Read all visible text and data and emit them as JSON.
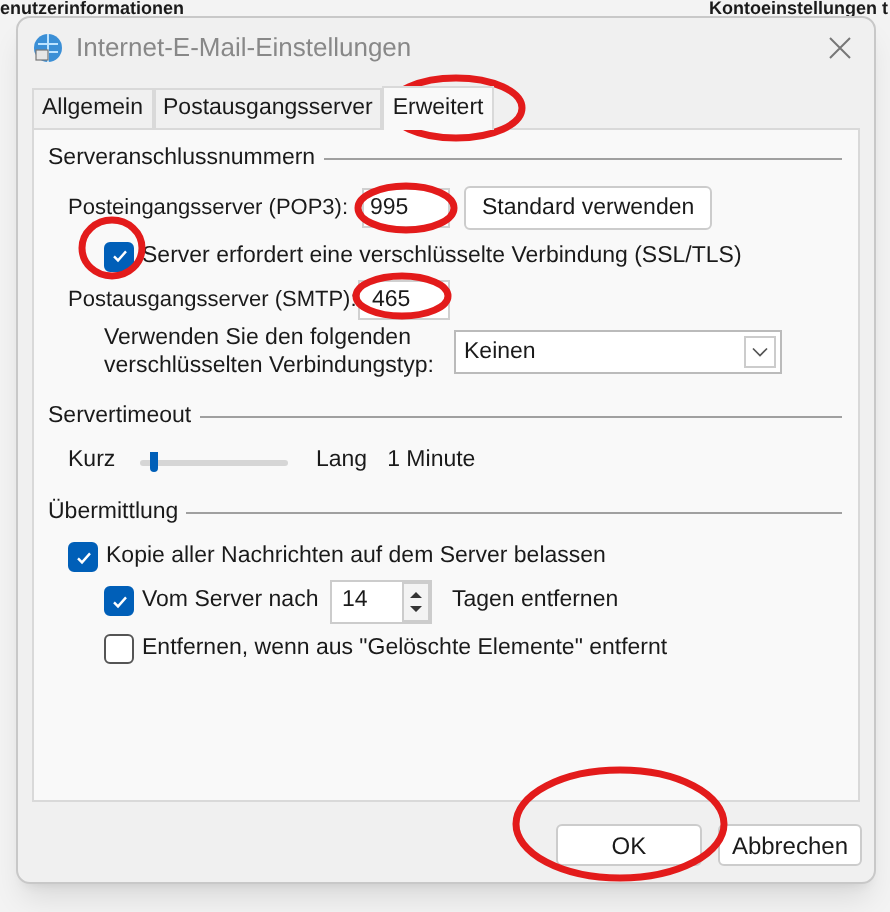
{
  "background": {
    "headings": [
      "enutzerinformationen",
      "Kontoeinstellungen t"
    ]
  },
  "dialog": {
    "title": "Internet-E-Mail-Einstellungen",
    "tabs": [
      {
        "label": "Allgemein",
        "selected": false
      },
      {
        "label": "Postausgangsserver",
        "selected": false
      },
      {
        "label": "Erweitert",
        "selected": true
      }
    ],
    "ports": {
      "heading": "Serveranschlussnummern",
      "incoming_label": "Posteingangsserver (POP3):",
      "incoming_value": "995",
      "default_button": "Standard verwenden",
      "ssl": {
        "label": "Server erfordert eine verschlüsselte Verbindung (SSL/TLS)",
        "checked": true
      },
      "outgoing_label": "Postausgangsserver (SMTP):",
      "outgoing_value": "465",
      "encryption_label": "Verwenden Sie den folgenden verschlüsselten Verbindungstyp:",
      "encryption_value": "Keinen"
    },
    "timeout": {
      "heading": "Servertimeout",
      "min_label": "Kurz",
      "max_label": "Lang",
      "level": 0.1,
      "reading": "1 Minute"
    },
    "delivery": {
      "heading": "Übermittlung",
      "keep_copy": {
        "label": "Kopie aller Nachrichten auf dem Server belassen",
        "checked": true
      },
      "remove_after": {
        "label": "Vom Server nach",
        "checked": true,
        "value": "14",
        "suffix": "Tagen entfernen"
      },
      "remove_deleted": {
        "label": "Entfernen, wenn aus \"Gelöschte Elemente\" entfernt",
        "checked": false
      }
    },
    "buttons": [
      "OK",
      "Abbrechen"
    ]
  }
}
